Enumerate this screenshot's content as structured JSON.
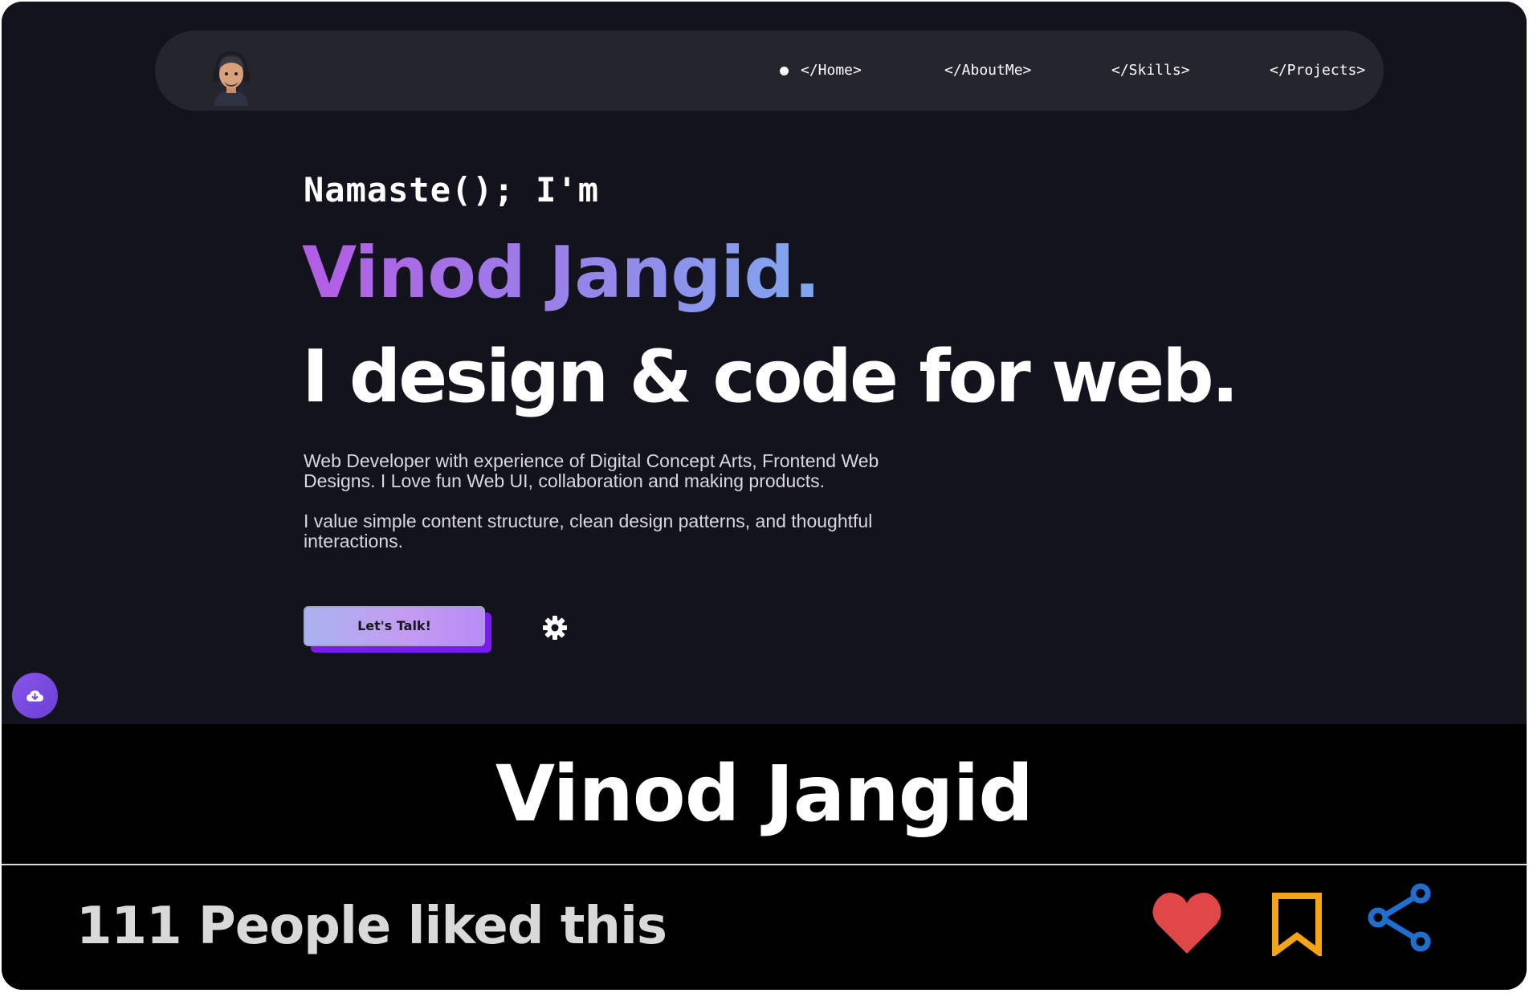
{
  "preview": {
    "nav": {
      "avatar_alt": "avatar",
      "items": [
        {
          "label": "</Home>",
          "active": true
        },
        {
          "label": "</AboutMe>",
          "active": false
        },
        {
          "label": "</Skills>",
          "active": false
        },
        {
          "label": "</Projects>",
          "active": false
        }
      ]
    },
    "hero": {
      "greeting": "Namaste(); I'm",
      "name": "Vinod Jangid.",
      "tagline": "I design & code for web.",
      "paragraph_1": "Web Developer with experience of Digital Concept Arts, Frontend Web Designs. I Love fun Web UI, collaboration and making products.",
      "paragraph_2": "I value simple content structure, clean design patterns, and thoughtful interactions.",
      "cta_label": "Let's Talk!"
    },
    "icons": {
      "settings": "gear-icon",
      "download": "cloud-download-icon"
    },
    "colors": {
      "background": "#13131d",
      "navbar": "#25252d",
      "name_gradient_start": "#b45ce6",
      "name_gradient_end": "#7fa7ee",
      "cta_shadow": "#7a1cf0"
    }
  },
  "caption": {
    "title": "Vinod Jangid"
  },
  "footer": {
    "likes_text": "111 People liked this",
    "actions": [
      {
        "icon": "heart-icon",
        "color": "#e04848"
      },
      {
        "icon": "bookmark-icon",
        "color": "#f2a516"
      },
      {
        "icon": "share-icon",
        "color": "#1e6fd0"
      }
    ]
  }
}
